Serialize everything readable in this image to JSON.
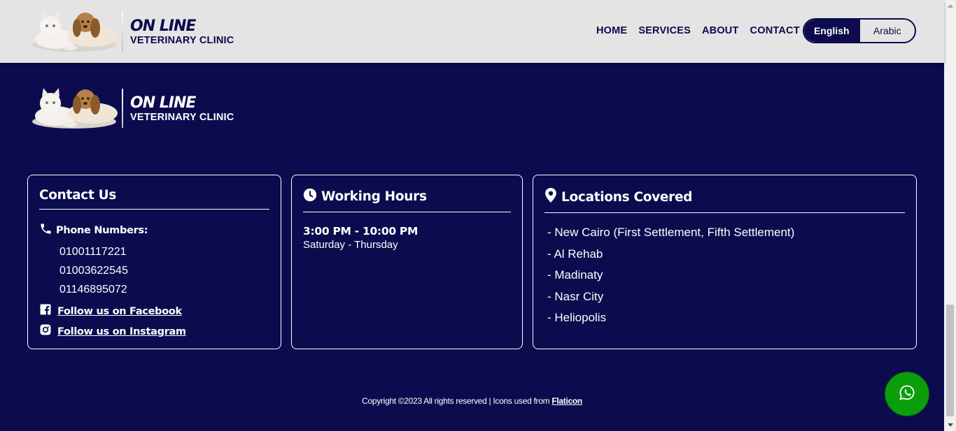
{
  "header": {
    "brand": {
      "title": "ON LINE",
      "subtitle": "VETERINARY CLINIC",
      "logo_icon": "cat-and-dog-logo"
    },
    "nav": [
      {
        "label": "HOME"
      },
      {
        "label": "SERVICES"
      },
      {
        "label": "ABOUT"
      },
      {
        "label": "CONTACT"
      }
    ],
    "language": {
      "english": "English",
      "arabic": "Arabic",
      "selected": "English"
    }
  },
  "footer": {
    "brand": {
      "title": "ON LINE",
      "subtitle": "VETERINARY CLINIC"
    },
    "contact": {
      "title": "Contact Us",
      "phone_heading": "Phone Numbers:",
      "phones": [
        "01001117221",
        "01003622545",
        "01146895072"
      ],
      "facebook": "Follow us on Facebook",
      "instagram": "Follow us on Instagram"
    },
    "hours": {
      "title": "Working Hours",
      "time": "3:00 PM - 10:00 PM",
      "days": "Saturday - Thursday"
    },
    "locations": {
      "title": "Locations Covered",
      "items": [
        "- New Cairo (First Settlement, Fifth Settlement)",
        "- Al Rehab",
        "- Madinaty",
        "- Nasr City",
        "- Heliopolis"
      ]
    },
    "copyright": {
      "text": "Copyright ©2023 All rights reserved | Icons used from ",
      "link": "Flaticon"
    }
  },
  "colors": {
    "navy": "#0b0b4e",
    "header_bg": "#e4e4e4",
    "whatsapp": "#0a9e0a"
  }
}
